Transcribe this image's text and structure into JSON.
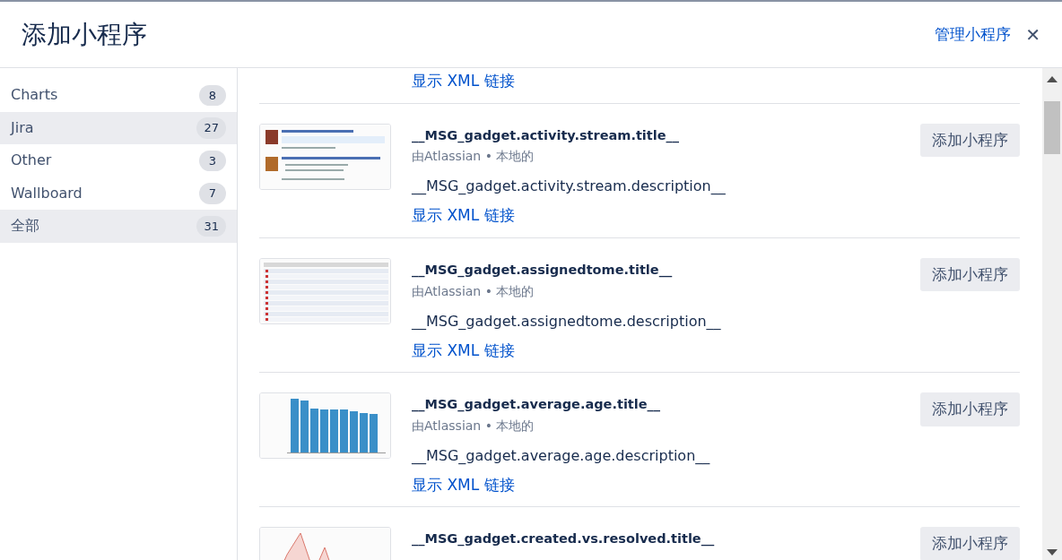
{
  "dialog": {
    "title": "添加小程序",
    "manage_link": "管理小程序",
    "close": "✕"
  },
  "sidebar": {
    "items": [
      {
        "label": "Charts",
        "count": "8",
        "selected": false
      },
      {
        "label": "Jira",
        "count": "27",
        "selected": true
      },
      {
        "label": "Other",
        "count": "3",
        "selected": false
      },
      {
        "label": "Wallboard",
        "count": "7",
        "selected": false
      },
      {
        "label": "全部",
        "count": "31",
        "selected": true
      }
    ]
  },
  "gadgets": [
    {
      "link": "显示 XML 链接"
    },
    {
      "title": "__MSG_gadget.activity.stream.title__",
      "author": "由Atlassian • 本地的",
      "description": "__MSG_gadget.activity.stream.description__",
      "link": "显示 XML 链接",
      "button": "添加小程序"
    },
    {
      "title": "__MSG_gadget.assignedtome.title__",
      "author": "由Atlassian • 本地的",
      "description": "__MSG_gadget.assignedtome.description__",
      "link": "显示 XML 链接",
      "button": "添加小程序"
    },
    {
      "title": "__MSG_gadget.average.age.title__",
      "author": "由Atlassian • 本地的",
      "description": "__MSG_gadget.average.age.description__",
      "link": "显示 XML 链接",
      "button": "添加小程序"
    },
    {
      "title": "__MSG_gadget.created.vs.resolved.title__",
      "button": "添加小程序"
    }
  ]
}
